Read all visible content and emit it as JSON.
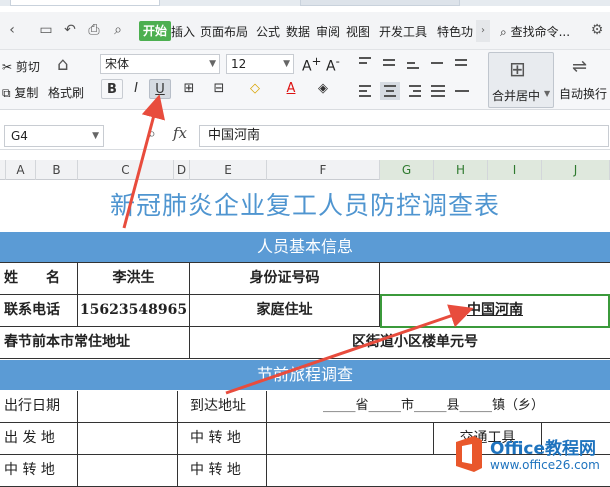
{
  "menubar": {
    "start_tab": "开始",
    "items": [
      "插入",
      "页面布局",
      "公式",
      "数据",
      "审阅",
      "视图",
      "开发工具",
      "特色功"
    ],
    "search": "查找命令..."
  },
  "ribbon": {
    "cut": "剪切",
    "copy": "复制",
    "format_painter": "格式刷",
    "font_name": "宋体",
    "font_size": "12",
    "bold": "B",
    "italic": "I",
    "underline": "U",
    "merge_center": "合并居中",
    "auto_wrap": "自动换行"
  },
  "formula_bar": {
    "cell_ref": "G4",
    "fx": "fx",
    "content": "中国河南"
  },
  "columns": [
    "A",
    "B",
    "C",
    "D",
    "E",
    "F",
    "G",
    "H",
    "I",
    "J"
  ],
  "sheet": {
    "title": "新冠肺炎企业复工人员防控调查表",
    "section1": "人员基本信息",
    "name_label": "姓　　名",
    "name_value": "李洪生",
    "id_label": "身份证号码",
    "phone_label": "联系电话",
    "phone_value": "15623548965",
    "home_label": "家庭住址",
    "home_value": "中国河南",
    "residence_label": "春节前本市常住地址",
    "residence_value": "区街道小区楼单元号",
    "section2": "节前旅程调查",
    "travel_date": "出行日期",
    "arrival_addr": "到达地址",
    "arrival_fill": "_____省_____市_____县_____镇（乡）",
    "departure": "出 发 地",
    "transfer": "中 转 地",
    "transport": "交通工具",
    "transfer2_left": "中 转 地",
    "transfer2_mid": "中 转 地"
  },
  "watermark": {
    "line1": "Office教程网",
    "line2": "www.office26.com"
  },
  "colors": {
    "section_bg": "#5b9bd5",
    "title": "#4f95d0",
    "arrow": "#e84c3d",
    "selection": "#3b9a3b",
    "start_tab": "#4caf50"
  }
}
